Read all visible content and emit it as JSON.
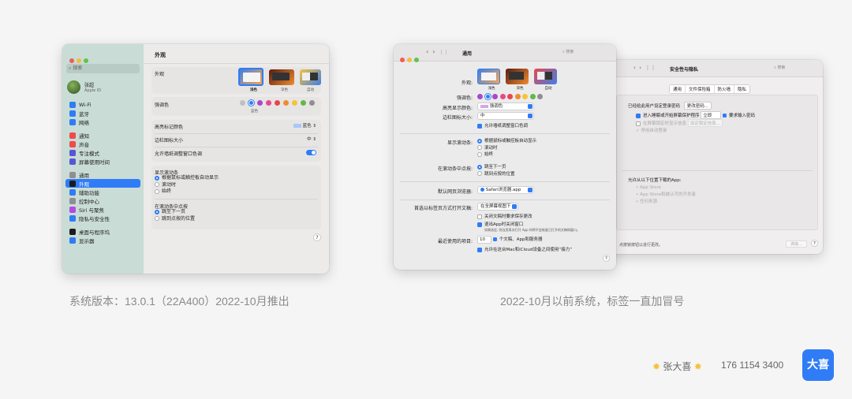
{
  "left_window": {
    "sidebar": {
      "search_placeholder": "搜索",
      "user_name": "张超",
      "user_sub": "Apple ID",
      "items": [
        {
          "label": "Wi-Fi",
          "color": "#2f7cf6"
        },
        {
          "label": "蓝牙",
          "color": "#2f7cf6"
        },
        {
          "label": "网络",
          "color": "#2f7cf6"
        },
        {
          "label": "通知",
          "color": "#ee4b4b"
        },
        {
          "label": "声音",
          "color": "#ee4b4b"
        },
        {
          "label": "专注模式",
          "color": "#5856d6"
        },
        {
          "label": "屏幕使用时间",
          "color": "#5856d6"
        },
        {
          "label": "通用",
          "color": "#8e8e93"
        },
        {
          "label": "外观",
          "color": "#1c1c1e"
        },
        {
          "label": "辅助功能",
          "color": "#2f7cf6"
        },
        {
          "label": "控制中心",
          "color": "#8e8e93"
        },
        {
          "label": "Siri 与聚焦",
          "color": "#b44be0"
        },
        {
          "label": "隐私与安全性",
          "color": "#2f7cf6"
        },
        {
          "label": "桌面与程序坞",
          "color": "#1c1c1e"
        },
        {
          "label": "显示器",
          "color": "#2f7cf6"
        }
      ]
    },
    "title": "外观",
    "appearance_label": "外观",
    "appearance_options": [
      "浅色",
      "深色",
      "自动"
    ],
    "accent_label": "强调色",
    "accent_selected": "蓝色",
    "accent_colors": [
      "#c0c0c0",
      "#2f7cf6",
      "#a64ac9",
      "#e54a8d",
      "#e5484d",
      "#f08c2e",
      "#f4c33b",
      "#62b946",
      "#8e8e93"
    ],
    "highlight_label": "高亮标记颜色",
    "highlight_value": "蓝色",
    "sidebar_icon_label": "边栏图标大小",
    "sidebar_icon_value": "中",
    "tinting_label": "允许墙纸调整窗口色调",
    "scrollbars_label": "显示滚动条",
    "scrollbars_options": [
      "根据鼠标或触控板自动显示",
      "滚动时",
      "始终"
    ],
    "click_label": "在滚动条中点按",
    "click_options": [
      "跳至下一页",
      "跳到点按的位置"
    ],
    "help": "?"
  },
  "right_front": {
    "title": "通用",
    "search_placeholder": "搜索",
    "appearance_label": "外观:",
    "appearance_options": [
      "浅色",
      "深色",
      "自动"
    ],
    "accent_label": "强调色:",
    "accent_colors": [
      "#a64ac9",
      "#2f7cf6",
      "#a64ac9",
      "#e54a8d",
      "#e5484d",
      "#f08c2e",
      "#f4c33b",
      "#62b946",
      "#8e8e93"
    ],
    "highlight_label": "高亮显示颜色:",
    "highlight_value": "强调色",
    "sidebar_label": "边栏图标大小:",
    "sidebar_value": "中",
    "tinting": "允许墙纸调整窗口色调",
    "scroll_label": "显示滚动条:",
    "scroll_options": [
      "根据鼠标或触控板自动显示",
      "滚动时",
      "始终"
    ],
    "click_label": "在滚动条中点按:",
    "click_options": [
      "跳至下一页",
      "跳到点按的位置"
    ],
    "browser_label": "默认网页浏览器:",
    "browser_value": "Safari浏览器.app",
    "tabs_label": "首选以标签页方式打开文稿:",
    "tabs_value": "在全屏幕视图下",
    "ask_keep": "关闭文稿时要求保存更改",
    "close_windows": "退出App时关闭窗口",
    "close_note": "如果选定, 则当您再次打开 App 时将不会恢复已打开的文稿和窗口。",
    "recent_label": "最近使用的项目:",
    "recent_value": "10",
    "recent_suffix": "个文稿、App和服务器",
    "handoff": "允许在这台Mac和iCloud设备之间使用“接力”",
    "help": "?"
  },
  "right_back": {
    "title": "安全性与隐私",
    "search_placeholder": "搜索",
    "tabs": [
      "通用",
      "文件保险箱",
      "防火墙",
      "隐私"
    ],
    "password_text": "已经给此用户设定登录密码",
    "change_pw": "更改密码...",
    "require_pw": "进入睡眠或开始屏幕保护程序",
    "require_value": "立即",
    "require_suffix": "要求输入密码",
    "show_msg": "在屏幕锁定时显示信息",
    "set_msg": "设定锁定信息...",
    "auto_login": "停用自动登录",
    "allow_label": "允许从以下位置下载的App:",
    "allow_options": [
      "App Store",
      "App Store和被认可的开发者",
      "任何来源"
    ],
    "lock_text": "点按锁按钮以进行更改。",
    "advanced": "高级...",
    "help": "?"
  },
  "captions": {
    "left": "系统版本：13.0.1（22A400）2022-10月推出",
    "right": "2022-10月以前系统，标签一直加冒号"
  },
  "footer": {
    "name": "张大喜",
    "phone": "176 1154 3400",
    "logo": "大喜"
  }
}
